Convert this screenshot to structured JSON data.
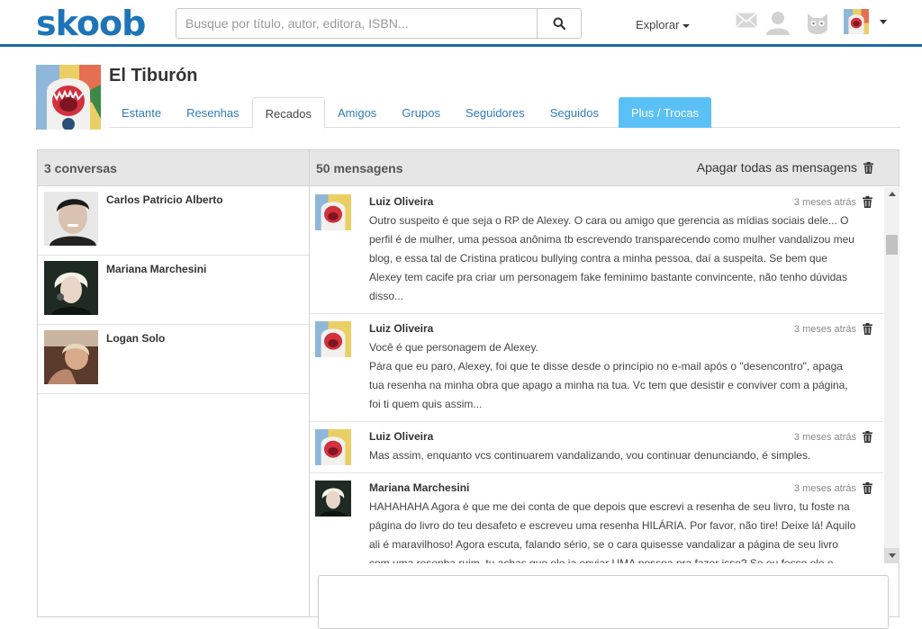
{
  "brand": {
    "name": "skoob",
    "color": "#1d75b8"
  },
  "search": {
    "placeholder": "Busque por título, autor, editora, ISBN..."
  },
  "nav": {
    "explore_label": "Explorar"
  },
  "header_icons": [
    "mail-icon",
    "user-icon",
    "cat-mascot-icon",
    "avatar"
  ],
  "profile": {
    "name": "El Tiburón",
    "tabs": [
      {
        "label": "Estante"
      },
      {
        "label": "Resenhas"
      },
      {
        "label": "Recados",
        "active": true
      },
      {
        "label": "Amigos"
      },
      {
        "label": "Grupos"
      },
      {
        "label": "Seguidores"
      },
      {
        "label": "Seguidos"
      },
      {
        "label": "Plus / Trocas",
        "highlight": "#5bc0f5"
      }
    ]
  },
  "conversations": {
    "header": "3 conversas",
    "items": [
      {
        "name": "Carlos Patricio Alberto"
      },
      {
        "name": "Mariana Marchesini"
      },
      {
        "name": "Logan Solo"
      }
    ]
  },
  "messages": {
    "header": "50 mensagens",
    "delete_all_label": "Apagar todas as mensagens",
    "items": [
      {
        "author": "Luiz Oliveira",
        "time": "3 meses atrás",
        "lines": [
          "Outro suspeito é que seja o RP de Alexey. O cara ou amigo que gerencia as mídias sociais dele... O perfil é de mulher, uma pessoa anônima tb escrevendo transparecendo como mulher vandalizou meu blog, e essa tal de Cristina praticou bullying contra a minha pessoa, daí a suspeita. Se bem que Alexey tem cacife pra criar um personagem fake feminimo bastante convincente, não tenho dúvidas disso..."
        ]
      },
      {
        "author": "Luiz Oliveira",
        "time": "3 meses atrás",
        "lines": [
          "Você é que personagem de Alexey.",
          "Pára que eu paro, Alexey, foi que te disse desde o princípio no e-mail após o \"desencontro\", apaga tua resenha na minha obra que apago a minha na tua. Vc tem que desistir e conviver com a página, foi ti quem quis assim..."
        ]
      },
      {
        "author": "Luiz Oliveira",
        "time": "3 meses atrás",
        "lines": [
          "Mas assim, enquanto vcs continuarem vandalizando, vou continuar denunciando, é simples."
        ]
      },
      {
        "author": "Mariana Marchesini",
        "time": "3 meses atrás",
        "lines": [
          "HAHAHAHA Agora é que me dei conta de que depois que escrevi a resenha de seu livro, tu foste na página do livro do teu desafeto e escreveu uma resenha HILÁRIA. Por favor, não tire! Deixe lá! Aquilo ali é maravilhoso! Agora escuta, falando sério, se o cara quisesse vandalizar a página de seu livro com uma resenha ruim, tu achas que ele ia enviar UMA pessoa pra fazer isso? Se eu fosse ele e tivesse todo esse poder que você imagina, eu faria com que muitas pessoas fizessem isso."
        ]
      }
    ]
  }
}
